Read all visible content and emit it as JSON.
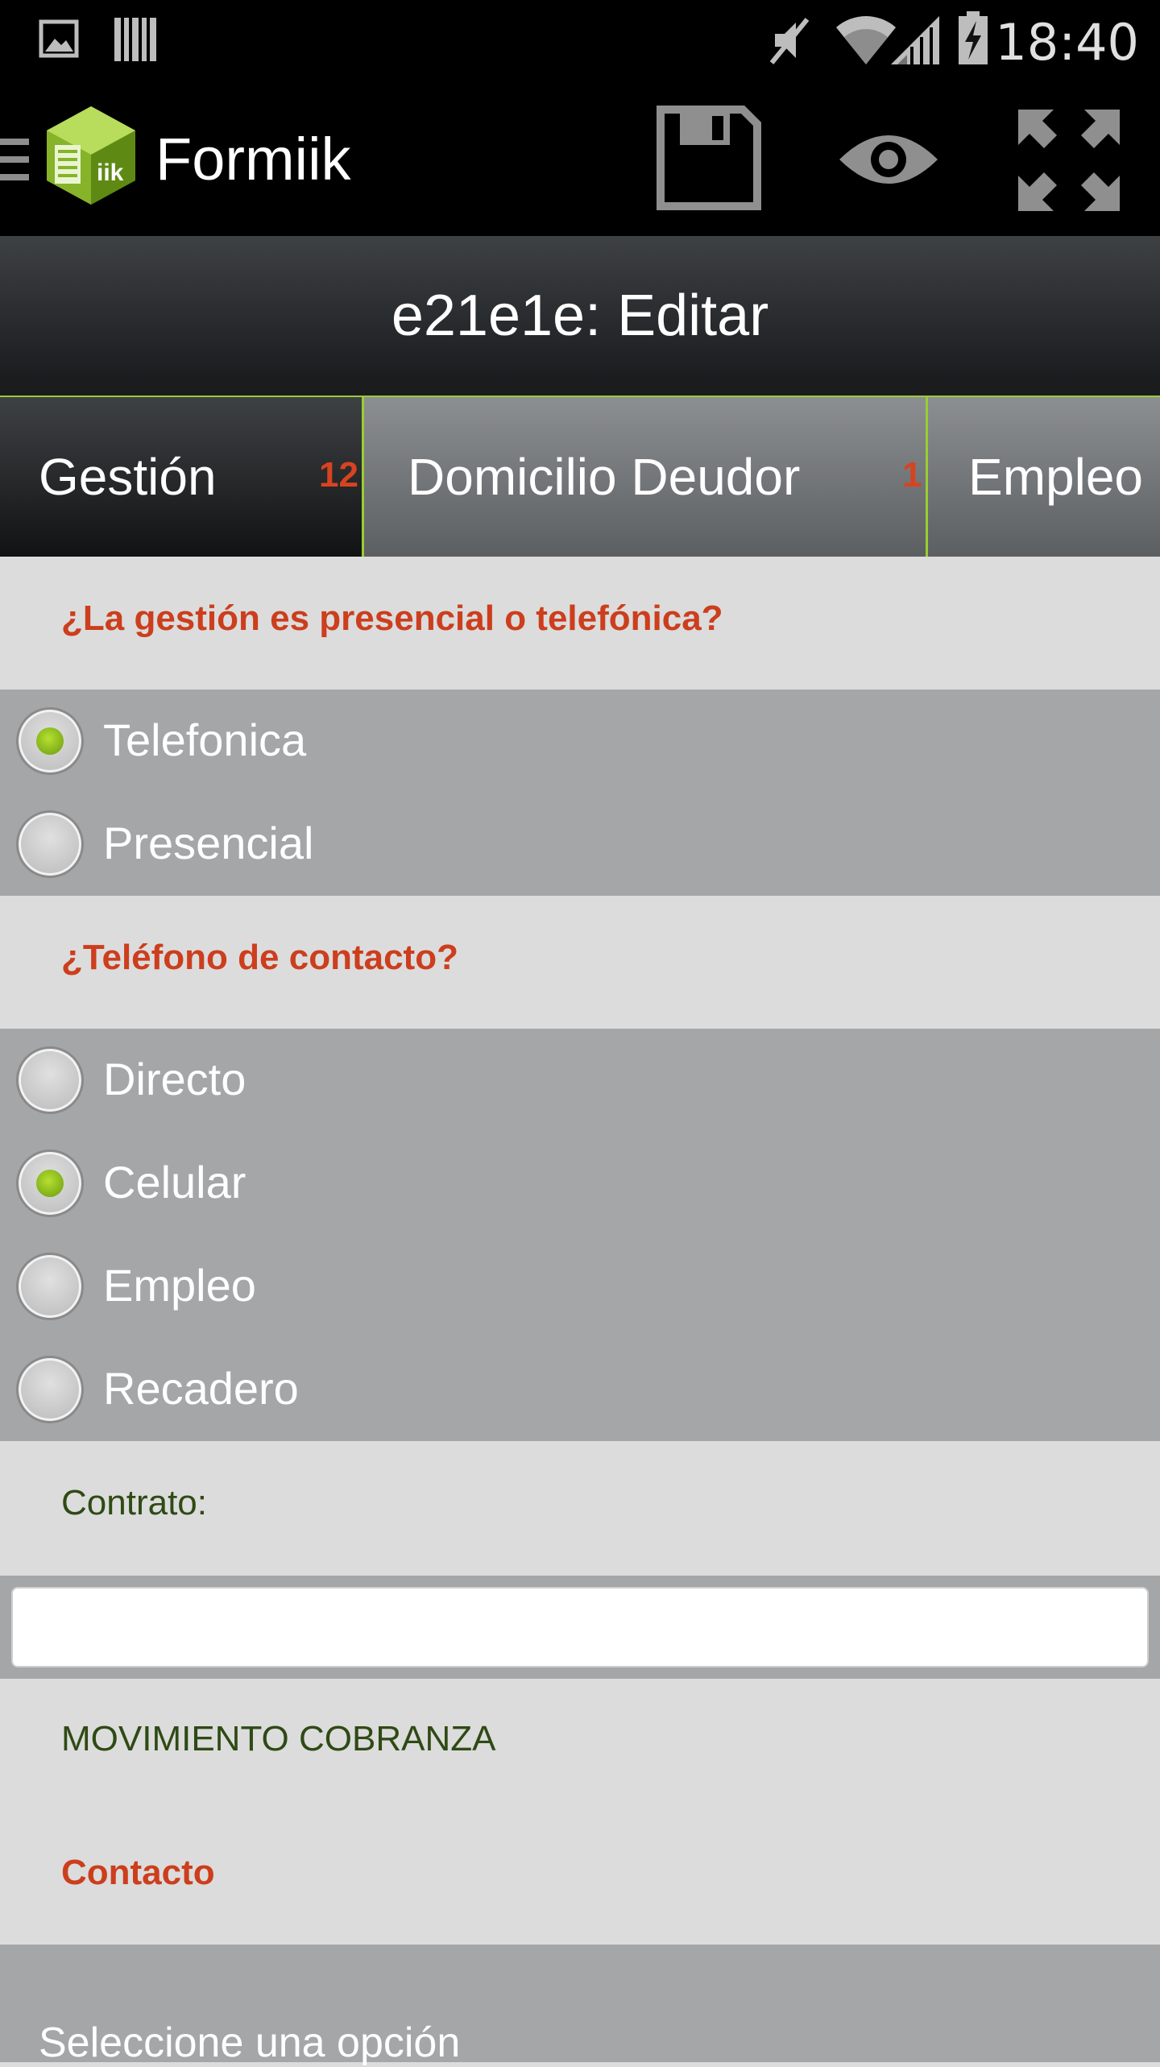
{
  "status_bar": {
    "time": "18:40",
    "icons": [
      "image-icon",
      "barcode-icon",
      "mute-icon",
      "wifi-icon",
      "signal-icon",
      "battery-charging-icon"
    ]
  },
  "action_bar": {
    "app_name": "Formiik",
    "actions": [
      "save-icon",
      "eye-icon",
      "fullscreen-icon"
    ]
  },
  "title": "e21e1e: Editar",
  "tabs": [
    {
      "label": "Gestión",
      "badge": "12"
    },
    {
      "label": "Domicilio Deudor",
      "badge": "1"
    },
    {
      "label": "Empleo I",
      "badge": ""
    }
  ],
  "form": {
    "q1": {
      "question": "¿La gestión es presencial o telefónica?",
      "options": [
        {
          "label": "Telefonica",
          "checked": true
        },
        {
          "label": "Presencial",
          "checked": false
        }
      ]
    },
    "q2": {
      "question": "¿Teléfono de contacto?",
      "options": [
        {
          "label": "Directo",
          "checked": false
        },
        {
          "label": "Celular",
          "checked": true
        },
        {
          "label": "Empleo",
          "checked": false
        },
        {
          "label": "Recadero",
          "checked": false
        }
      ]
    },
    "contrato": {
      "label": "Contrato:",
      "value": ""
    },
    "section_heading": "MOVIMIENTO COBRANZA",
    "contacto": {
      "question": "Contacto",
      "select_value": "Seleccione una opción"
    }
  },
  "colors": {
    "accent": "#9acd32",
    "question_red": "#cc3e1d",
    "label_green": "#2f4a15",
    "option_bg": "#a5a6a8",
    "section_bg": "#dcdcdc"
  }
}
